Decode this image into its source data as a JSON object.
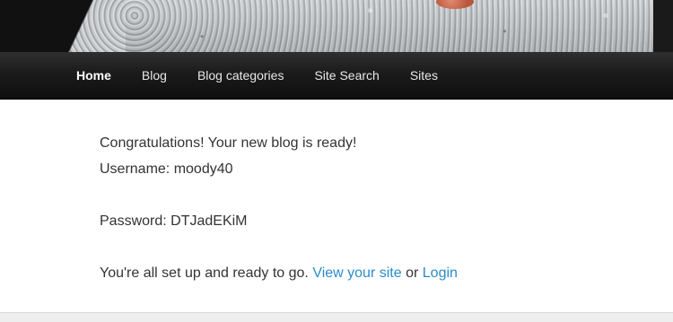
{
  "header": {
    "image_icon": "granite-photo"
  },
  "nav": {
    "items": [
      {
        "label": "Home"
      },
      {
        "label": "Blog"
      },
      {
        "label": "Blog categories"
      },
      {
        "label": "Site Search"
      },
      {
        "label": "Sites"
      }
    ],
    "active_index": 0
  },
  "content": {
    "congrats": "Congratulations! Your new blog is ready!",
    "username_line": "Username: moody40",
    "password_line": "Password: DTJadEKiM",
    "setup_text": "You're all set up and ready to go.",
    "view_site_link": "View your site",
    "or_text": "or",
    "login_link": "Login"
  },
  "colors": {
    "link": "#2b8bc9",
    "nav_background": "#1b1b1b",
    "text": "#333333"
  }
}
